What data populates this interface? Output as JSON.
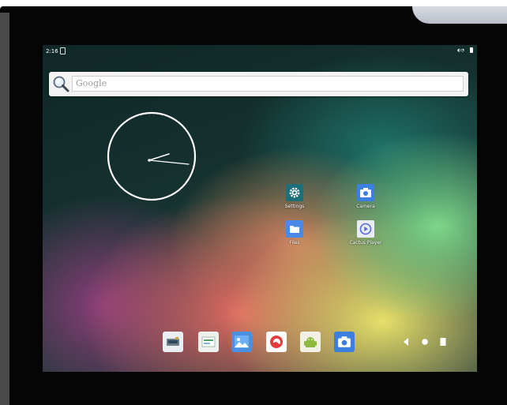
{
  "status_bar": {
    "time": "2:16"
  },
  "search": {
    "placeholder": "Google"
  },
  "apps": {
    "settings": "Settings",
    "camera": "Camera",
    "files": "Files",
    "cactus_player": "Cactus Player"
  },
  "dock": {
    "items": [
      "gallery-reader-icon",
      "file-manager-icon",
      "photos-icon",
      "browser-icon",
      "package-installer-icon",
      "camera-icon"
    ]
  },
  "colors": {
    "settings_bg": "#1d6f7a",
    "camera_bg": "#3d7fde",
    "files_bg": "#4a89e6",
    "cactus_bg": "#e8ecf7"
  }
}
